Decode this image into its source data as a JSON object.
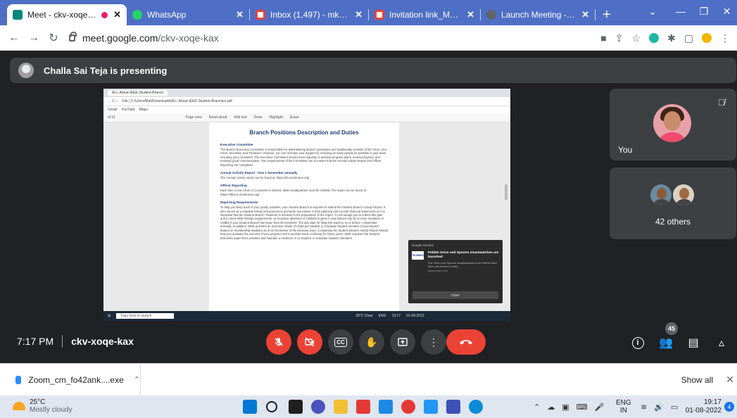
{
  "browser": {
    "tabs": [
      {
        "title": "Meet - ckv-xoqe-kax",
        "active": true,
        "recording": true,
        "favicon_color": "#00897b"
      },
      {
        "title": "WhatsApp",
        "favicon_color": "#25d366"
      },
      {
        "title": "Inbox (1,497) - mkathyaya",
        "favicon_color": "#ea4335"
      },
      {
        "title": "Invitation link_MV24 // D",
        "favicon_color": "#ea4335"
      },
      {
        "title": "Launch Meeting - Zoom",
        "favicon_color": "#5f6368"
      }
    ],
    "new_tab_glyph": "+",
    "url_host": "meet.google.com",
    "url_path": "/ckv-xoqe-kax"
  },
  "meet": {
    "presenting_banner": "Challa Sai Teja is presenting",
    "meeting_code": "ckv-xoqe-kax",
    "time": "7:17 PM",
    "participants_count": "45",
    "tiles": {
      "you_label": "You",
      "others_label": "42 others"
    },
    "colors": {
      "hangup": "#ea4335",
      "surface": "#3c4043",
      "background": "#202124"
    }
  },
  "shared_screen": {
    "tab_title": "ALL-About-IEEE-Student-Branch",
    "file_url": "File | C:/Users/Mali/Downloads/ALL-About-IEEE-Student-Branches.pdf",
    "bookmarks": [
      "Gmail",
      "YouTube",
      "Maps"
    ],
    "page_indicator": "of 11",
    "pdf_tools": [
      "Page view",
      "Read aloud",
      "Add text",
      "Draw",
      "Highlight",
      "Erase"
    ],
    "page": {
      "title": "Branch Positions Description and Duties",
      "sections": [
        {
          "heading": "Executive Committee",
          "text": "The Branch Executive Committee is responsible for administering Branch operations and traditionally consists of the Chair, Vice-Chair, Secretary, and Treasurer. However, you can increase your support by including as many people as possible in your team, including your Counselor. The Executive Committee should meet regularly to develop program plans, review progress, and maintain good communication. Two requirements of the Committee are to ensure that the Annual Activity Report and Officer Reporting are completed."
        },
        {
          "heading": "Annual Activity Report - Due 1 November annually",
          "text": "The Annual Activity report can be found at: https://sb.vtools.ieee.org/."
        },
        {
          "heading": "Officer Reporting",
          "text": "Each time a new Chair or Counselor is elected, IEEE Headquarters must be notified. The report can be found at: https://officers.vtools.ieee.org/."
        },
        {
          "heading": "Reporting Requirements",
          "text": "To help you keep track of your yearly activities, your Student Branch is required to submit the Student Branch Activity Report. It also serves as a valuable historical document to aid future executives in their planning and records financial statements so it is important that the Student Branch Treasurer is involved in the preparation of the report. To encourage you to submit this plan and to meet IEEE Rebate requirements, an incentive allotment of US$100 is given if your Branch has 50 or more members or US$50 if your Student Branch has fewer than 50 members. The due date for filing this report is on or before 1 November annually. In addition, IEEE provides an incentive rebate of US$2 per Student or Graduate Student member of your Branch (based on membership statistics as of 31 December of the previous year). Completing the Student Branch Activity Report should help you evaluate the success of your program and to provide some continuity for future years. IEEE requires that Student Branches report their activities and maintain a minimum of 12 Student or Graduate Student members."
        }
      ]
    },
    "notification": {
      "app": "Google Chrome",
      "logo_text": "TECHBRO",
      "title": "Pebble Orion and Spectra smartwatches are launched",
      "body": "The Orion and Spectra smartwatches from Pebble have been introduced in India.",
      "site": "www.techbro.com",
      "button": "Close"
    },
    "taskbar": {
      "search": "Type here to search",
      "weather": "28°C Clear",
      "lang": "ENG",
      "time": "19:17",
      "date": "01-08-2022"
    }
  },
  "downloads": {
    "item": "Zoom_cm_fo42ank....exe",
    "show_all": "Show all"
  },
  "windows": {
    "temperature": "25°C",
    "weather": "Mostly cloudy",
    "lang_top": "ENG",
    "lang_bottom": "IN",
    "time": "19:17",
    "date": "01-08-2022",
    "notification_count": "4"
  }
}
